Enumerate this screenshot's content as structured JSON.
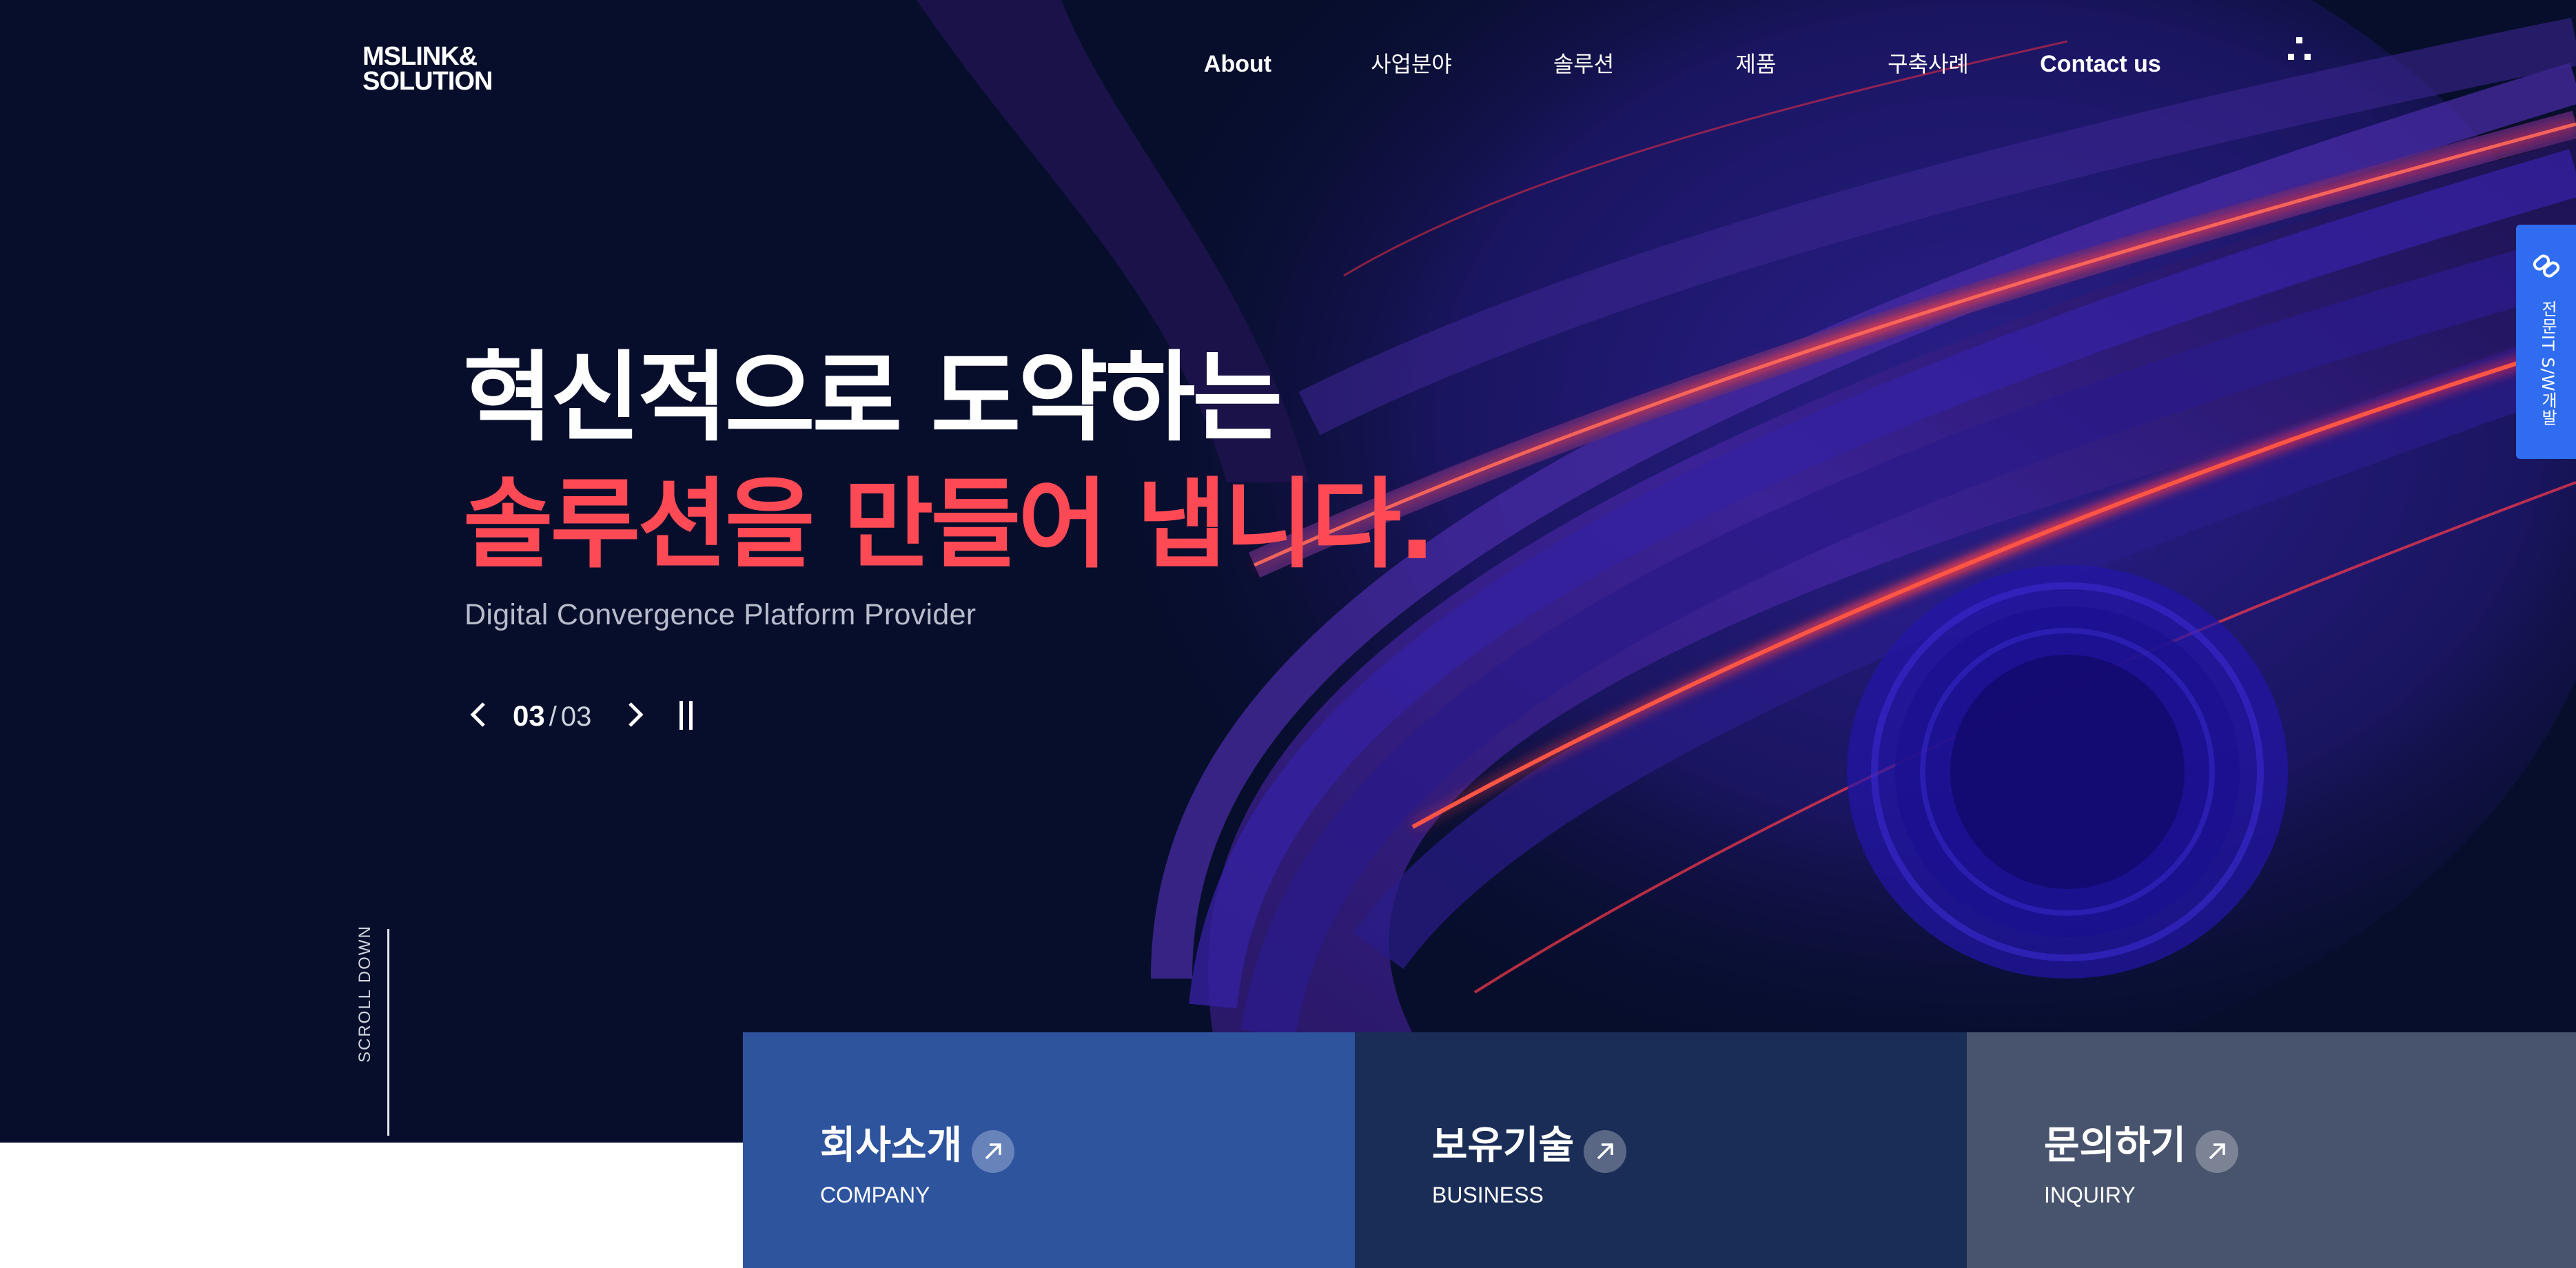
{
  "logo": {
    "line1": "MSLINK&",
    "line2": "SOLUTION"
  },
  "nav": {
    "items": [
      "About",
      "사업분야",
      "솔루션",
      "제품",
      "구축사례",
      "Contact us"
    ]
  },
  "side_badge": {
    "label": "전문IT S/W개발"
  },
  "hero": {
    "headline_line1": "혁신적으로 도약하는",
    "headline_line2": "솔루션을 만들어 냅니다.",
    "subtitle": "Digital Convergence Platform Provider",
    "slide_current": "03",
    "slide_separator": "/",
    "slide_total": "03",
    "scroll_label": "SCROLL DOWN"
  },
  "cards": [
    {
      "title": "회사소개",
      "subtitle": "COMPANY",
      "color": "#2e549e"
    },
    {
      "title": "보유기술",
      "subtitle": "BUSINESS",
      "color": "#1a2d57"
    },
    {
      "title": "문의하기",
      "subtitle": "INQUIRY",
      "color": "#48546d"
    }
  ],
  "colors": {
    "accent": "#ff4a55",
    "hero_bg": "#070e2c",
    "badge": "#2f6cf0"
  },
  "icons": [
    "menu-icon",
    "link-icon",
    "chevron-left-icon",
    "chevron-right-icon",
    "pause-icon",
    "arrow-up-right-icon"
  ]
}
